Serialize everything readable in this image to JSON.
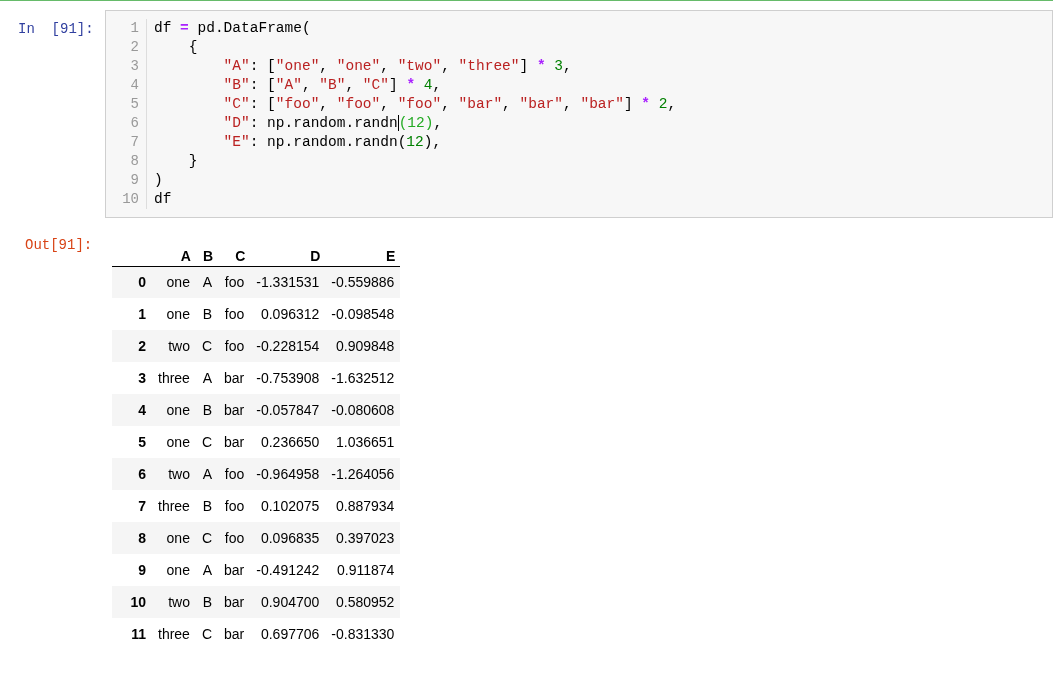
{
  "input_cell": {
    "prompt": "In  [91]:",
    "selected": true,
    "line_numbers": [
      "1",
      "2",
      "3",
      "4",
      "5",
      "6",
      "7",
      "8",
      "9",
      "10"
    ],
    "lines": [
      {
        "kind": "top",
        "tokens": [
          {
            "text": "df ",
            "kind": "plain"
          },
          {
            "text": "=",
            "kind": "operator"
          },
          {
            "text": " pd.DataFrame(",
            "kind": "plain"
          }
        ]
      },
      {
        "kind": "block",
        "tokens": [
          {
            "text": "{",
            "kind": "plain"
          }
        ]
      },
      {
        "kind": "entry",
        "tokens": [
          {
            "text": "\"A\"",
            "kind": "string"
          },
          {
            "text": ": [",
            "kind": "plain"
          },
          {
            "text": "\"one\"",
            "kind": "string"
          },
          {
            "text": ", ",
            "kind": "plain"
          },
          {
            "text": "\"one\"",
            "kind": "string"
          },
          {
            "text": ", ",
            "kind": "plain"
          },
          {
            "text": "\"two\"",
            "kind": "string"
          },
          {
            "text": ", ",
            "kind": "plain"
          },
          {
            "text": "\"three\"",
            "kind": "string"
          },
          {
            "text": "] ",
            "kind": "plain"
          },
          {
            "text": "* ",
            "kind": "operator"
          },
          {
            "text": "3",
            "kind": "number"
          },
          {
            "text": ",",
            "kind": "plain"
          }
        ]
      },
      {
        "kind": "entry",
        "tokens": [
          {
            "text": "\"B\"",
            "kind": "string"
          },
          {
            "text": ": [",
            "kind": "plain"
          },
          {
            "text": "\"A\"",
            "kind": "string"
          },
          {
            "text": ", ",
            "kind": "plain"
          },
          {
            "text": "\"B\"",
            "kind": "string"
          },
          {
            "text": ", ",
            "kind": "plain"
          },
          {
            "text": "\"C\"",
            "kind": "string"
          },
          {
            "text": "] ",
            "kind": "plain"
          },
          {
            "text": "* ",
            "kind": "operator"
          },
          {
            "text": "4",
            "kind": "number"
          },
          {
            "text": ",",
            "kind": "plain"
          }
        ]
      },
      {
        "kind": "entry",
        "tokens": [
          {
            "text": "\"C\"",
            "kind": "string"
          },
          {
            "text": ": [",
            "kind": "plain"
          },
          {
            "text": "\"foo\"",
            "kind": "string"
          },
          {
            "text": ", ",
            "kind": "plain"
          },
          {
            "text": "\"foo\"",
            "kind": "string"
          },
          {
            "text": ", ",
            "kind": "plain"
          },
          {
            "text": "\"foo\"",
            "kind": "string"
          },
          {
            "text": ", ",
            "kind": "plain"
          },
          {
            "text": "\"bar\"",
            "kind": "string"
          },
          {
            "text": ", ",
            "kind": "plain"
          },
          {
            "text": "\"bar\"",
            "kind": "string"
          },
          {
            "text": ", ",
            "kind": "plain"
          },
          {
            "text": "\"bar\"",
            "kind": "string"
          },
          {
            "text": "] ",
            "kind": "plain"
          },
          {
            "text": "* ",
            "kind": "operator"
          },
          {
            "text": "2",
            "kind": "number"
          },
          {
            "text": ",",
            "kind": "plain"
          }
        ]
      },
      {
        "kind": "entry",
        "tokens": [
          {
            "text": "\"D\"",
            "kind": "string"
          },
          {
            "text": ": np.random.randn",
            "kind": "plain",
            "cursor_after": true
          },
          {
            "text": "(12)",
            "kind": "matched"
          },
          {
            "text": ",",
            "kind": "plain"
          }
        ]
      },
      {
        "kind": "entry",
        "tokens": [
          {
            "text": "\"E\"",
            "kind": "string"
          },
          {
            "text": ": np.random.randn(",
            "kind": "plain"
          },
          {
            "text": "12",
            "kind": "number"
          },
          {
            "text": "),",
            "kind": "plain"
          }
        ]
      },
      {
        "kind": "block",
        "tokens": [
          {
            "text": "}",
            "kind": "plain"
          }
        ]
      },
      {
        "kind": "top",
        "tokens": [
          {
            "text": ")",
            "kind": "plain"
          }
        ]
      },
      {
        "kind": "top",
        "tokens": [
          {
            "text": "df",
            "kind": "plain"
          }
        ]
      }
    ]
  },
  "output_cell": {
    "prompt": "Out[91]:",
    "table": {
      "columns": [
        "A",
        "B",
        "C",
        "D",
        "E"
      ],
      "rows": [
        {
          "index": "0",
          "cells": [
            "one",
            "A",
            "foo",
            "-1.331531",
            "-0.559886"
          ]
        },
        {
          "index": "1",
          "cells": [
            "one",
            "B",
            "foo",
            "0.096312",
            "-0.098548"
          ]
        },
        {
          "index": "2",
          "cells": [
            "two",
            "C",
            "foo",
            "-0.228154",
            "0.909848"
          ]
        },
        {
          "index": "3",
          "cells": [
            "three",
            "A",
            "bar",
            "-0.753908",
            "-1.632512"
          ]
        },
        {
          "index": "4",
          "cells": [
            "one",
            "B",
            "bar",
            "-0.057847",
            "-0.080608"
          ]
        },
        {
          "index": "5",
          "cells": [
            "one",
            "C",
            "bar",
            "0.236650",
            "1.036651"
          ]
        },
        {
          "index": "6",
          "cells": [
            "two",
            "A",
            "foo",
            "-0.964958",
            "-1.264056"
          ]
        },
        {
          "index": "7",
          "cells": [
            "three",
            "B",
            "foo",
            "0.102075",
            "0.887934"
          ]
        },
        {
          "index": "8",
          "cells": [
            "one",
            "C",
            "foo",
            "0.096835",
            "0.397023"
          ]
        },
        {
          "index": "9",
          "cells": [
            "one",
            "A",
            "bar",
            "-0.491242",
            "0.911874"
          ]
        },
        {
          "index": "10",
          "cells": [
            "two",
            "B",
            "bar",
            "0.904700",
            "0.580952"
          ]
        },
        {
          "index": "11",
          "cells": [
            "three",
            "C",
            "bar",
            "0.697706",
            "-0.831330"
          ]
        }
      ]
    }
  }
}
